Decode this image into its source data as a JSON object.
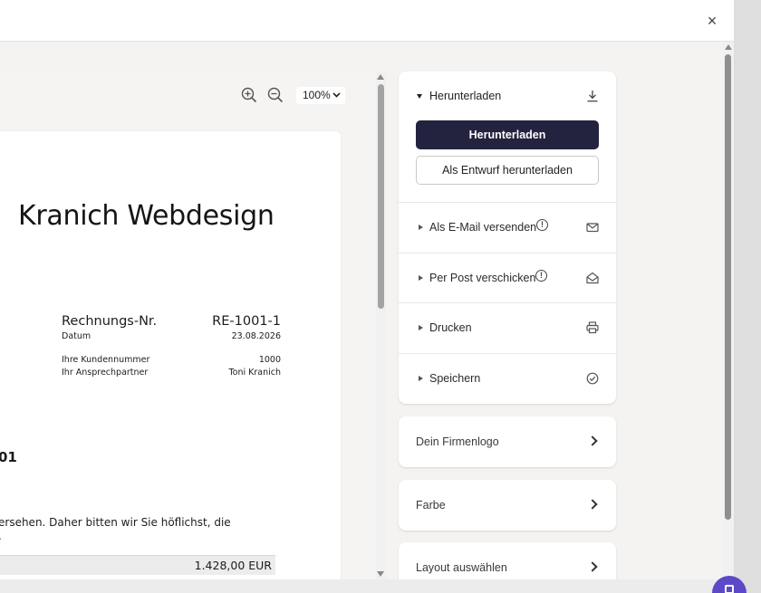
{
  "modal": {
    "close_icon": "×"
  },
  "preview": {
    "zoom": {
      "value": "100%"
    },
    "invoice": {
      "company": "Kranich Webdesign",
      "invoice_no_label": "Rechnungs-Nr.",
      "invoice_no": "RE-1001-1",
      "date_label": "Datum",
      "date": "23.08.2026",
      "customer_no_label": "Ihre Kundennummer",
      "customer_no": "1000",
      "contact_label": "Ihr Ansprechpartner",
      "contact": "Toni Kranich",
      "heading_partial": "01",
      "body_line1": "ersehen. Daher bitten wir Sie höflichst, die",
      "body_line2": ".",
      "total": "1.428,00 EUR"
    }
  },
  "sidebar": {
    "download": {
      "title": "Herunterladen",
      "primary_button": "Herunterladen",
      "secondary_button": "Als Entwurf herunterladen"
    },
    "email": {
      "label": "Als E-Mail versenden",
      "warn": "!"
    },
    "post": {
      "label": "Per Post verschicken",
      "warn": "!"
    },
    "print": {
      "label": "Drucken"
    },
    "save": {
      "label": "Speichern"
    },
    "logo": {
      "label": "Dein Firmenlogo"
    },
    "color": {
      "label": "Farbe"
    },
    "layout": {
      "label": "Layout auswählen"
    }
  },
  "colors": {
    "primary_button": "#23223f",
    "fab": "#5b49c9"
  }
}
